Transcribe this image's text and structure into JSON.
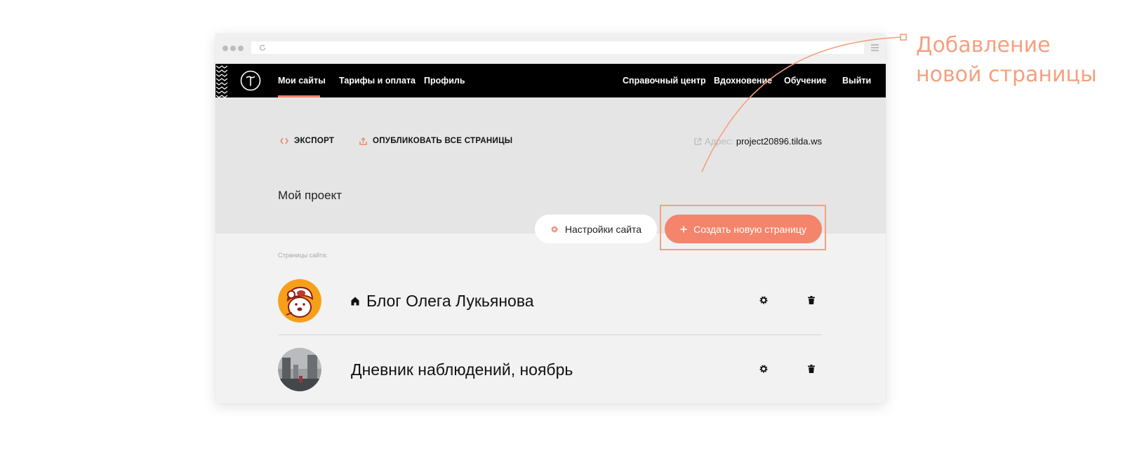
{
  "browser": {
    "icons": {
      "reload": "reload-icon",
      "menu": "hamburger-icon"
    }
  },
  "navbar": {
    "logo": "tilda-logo",
    "left_links": [
      {
        "label": "Мои сайты",
        "active": true
      },
      {
        "label": "Тарифы и оплата"
      },
      {
        "label": "Профиль"
      }
    ],
    "right_links": [
      {
        "label": "Справочный центр"
      },
      {
        "label": "Вдохновение"
      },
      {
        "label": "Обучение"
      },
      {
        "label": "Выйти"
      }
    ],
    "active_color": "#f4846b"
  },
  "project": {
    "export_label": "ЭКСПОРТ",
    "publish_all_label": "ОПУБЛИКОВАТЬ ВСЕ СТРАНИЦЫ",
    "address_label": "Адрес:",
    "address_value": "project20896.tilda.ws",
    "title": "Мой проект",
    "settings_button": "Настройки сайта",
    "create_button": "Создать новую страницу",
    "accent_color": "#f4846b"
  },
  "pages": {
    "section_label": "Страницы сайта:",
    "items": [
      {
        "title": "Блог Олега Лукьянова",
        "is_home": true,
        "thumb": "bear-avatar"
      },
      {
        "title": "Дневник наблюдений, ноябрь",
        "is_home": false,
        "thumb": "street-photo"
      }
    ]
  },
  "annotation": {
    "line1": "Добавление",
    "line2": "новой страницы",
    "color": "#f4a07f"
  }
}
